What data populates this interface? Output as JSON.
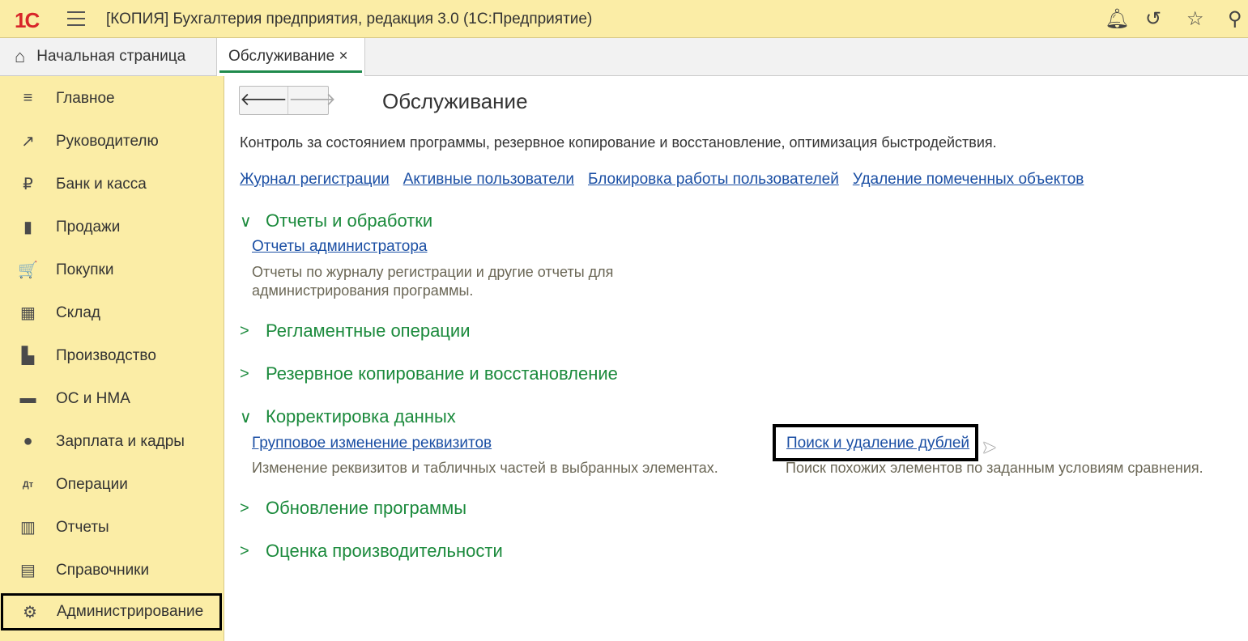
{
  "app": {
    "logo": "1С",
    "title": "[КОПИЯ] Бухгалтерия предприятия, редакция 3.0  (1С:Предприятие)"
  },
  "tabs": {
    "home": "Начальная страница",
    "active": "Обслуживание",
    "close": "×"
  },
  "sidebar": {
    "items": [
      {
        "label": "Главное",
        "icon": "≡"
      },
      {
        "label": "Руководителю",
        "icon": "↗"
      },
      {
        "label": "Банк и касса",
        "icon": "₽"
      },
      {
        "label": "Продажи",
        "icon": "▮"
      },
      {
        "label": "Покупки",
        "icon": "🛒"
      },
      {
        "label": "Склад",
        "icon": "▦"
      },
      {
        "label": "Производство",
        "icon": "▙"
      },
      {
        "label": "ОС и НМА",
        "icon": "▬"
      },
      {
        "label": "Зарплата и кадры",
        "icon": "●"
      },
      {
        "label": "Операции",
        "icon": "Дт"
      },
      {
        "label": "Отчеты",
        "icon": "▥"
      },
      {
        "label": "Справочники",
        "icon": "▤"
      },
      {
        "label": "Администрирование",
        "icon": "⚙"
      }
    ]
  },
  "page": {
    "back": "🡐",
    "forward": "🡒",
    "title": "Обслуживание",
    "description": "Контроль за состоянием программы, резервное копирование и восстановление, оптимизация быстродействия.",
    "links": [
      "Журнал регистрации",
      "Активные пользователи",
      "Блокировка работы пользователей",
      "Удаление помеченных объектов"
    ],
    "sections": [
      {
        "title": "Отчеты и обработки",
        "chevron": "∨"
      },
      {
        "title": "Регламентные операции",
        "chevron": ">"
      },
      {
        "title": "Резервное копирование и восстановление",
        "chevron": ">"
      },
      {
        "title": "Корректировка данных",
        "chevron": "∨"
      },
      {
        "title": "Обновление программы",
        "chevron": ">"
      },
      {
        "title": "Оценка производительности",
        "chevron": ">"
      }
    ],
    "reports_link": "Отчеты администратора",
    "reports_desc1": "Отчеты по журналу регистрации и другие отчеты для",
    "reports_desc2": "администрирования программы.",
    "group_link": "Групповое изменение реквизитов",
    "group_desc": "Изменение реквизитов и табличных частей в выбранных элементах.",
    "dup_link": "Поиск и удаление дублей",
    "dup_desc": "Поиск похожих элементов по заданным условиям сравнения."
  }
}
